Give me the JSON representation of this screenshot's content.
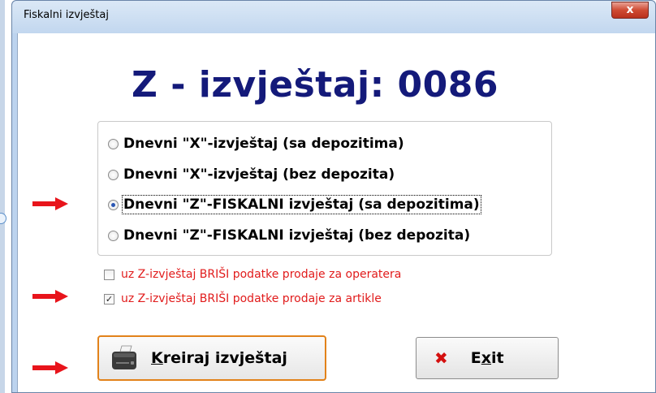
{
  "window": {
    "title": "Fiskalni izvještaj",
    "close_glyph": "x"
  },
  "headline": "Z - izvještaj: 0086",
  "report_options": [
    {
      "label": "Dnevni \"X\"-izvještaj (sa depozitima)",
      "selected": false
    },
    {
      "label": "Dnevni \"X\"-izvještaj (bez depozita)",
      "selected": false
    },
    {
      "label": "Dnevni \"Z\"-FISKALNI izvještaj (sa depozitima)",
      "selected": true
    },
    {
      "label": "Dnevni \"Z\"-FISKALNI izvještaj (bez depozita)",
      "selected": false
    }
  ],
  "checkboxes": [
    {
      "label": "uz Z-izvještaj BRIŠI podatke prodaje za operatera",
      "checked": false
    },
    {
      "label": "uz Z-izvještaj BRIŠI podatke prodaje za artikle",
      "checked": true
    }
  ],
  "buttons": {
    "create": {
      "accel": "K",
      "rest": "reiraj izvještaj"
    },
    "exit": {
      "pre": "E",
      "accel": "x",
      "post": "it",
      "icon_glyph": "✖"
    }
  },
  "colors": {
    "headline": "#141a7a",
    "checkbox_text": "#e11b1b",
    "arrow": "#e8141b",
    "create_button_border": "#e2821a",
    "exit_icon": "#d4100f"
  },
  "icons": {
    "arrow": "red-right-arrow-icon",
    "printer": "receipt-printer-icon",
    "exit": "red-x-icon"
  }
}
